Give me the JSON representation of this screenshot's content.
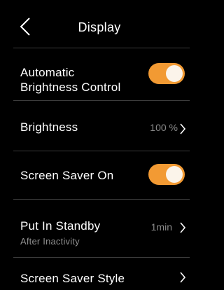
{
  "header": {
    "title": "Display",
    "back_icon": "chevron-left-icon"
  },
  "colors": {
    "background": "#000000",
    "accent": "#f29a33",
    "text": "#ffffff",
    "secondary_text": "#8a8a8a",
    "divider": "#3c3c3c"
  },
  "settings": {
    "auto_brightness": {
      "label_line1": "Automatic",
      "label_line2": "Brightness Control",
      "enabled": true
    },
    "brightness": {
      "label": "Brightness",
      "value": "100 %"
    },
    "screen_saver": {
      "label": "Screen Saver On",
      "enabled": true
    },
    "standby": {
      "label": "Put In Standby",
      "sublabel": "After Inactivity",
      "value": "1min"
    },
    "screen_saver_style": {
      "label": "Screen Saver Style"
    }
  }
}
